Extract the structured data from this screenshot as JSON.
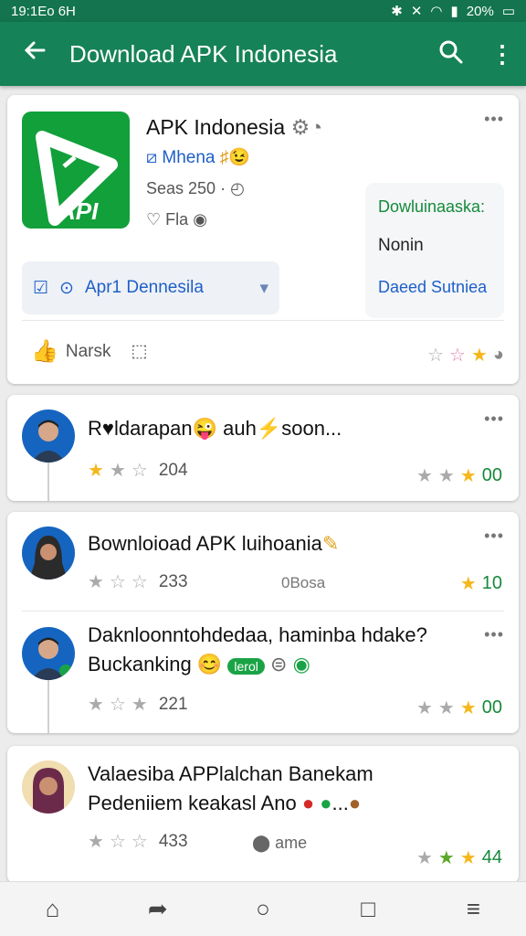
{
  "status_bar": {
    "time": "19:16",
    "left_text": "19:1Eo 6H",
    "battery": "20%"
  },
  "app_bar": {
    "title": "Download APK Indonesia"
  },
  "app_card": {
    "name": "APK Indonesia",
    "developer": "Mhena",
    "meta_line1": "Seas 250",
    "meta_line2": "Fla",
    "logo_text": "API",
    "side_title": "Dowluinaaska:",
    "side_value": "Nonin",
    "side_link": "Daeed Sutniea",
    "dropdown_label": "Apr1 Dennesila",
    "like_label": "Narsk"
  },
  "reviews": [
    {
      "title": "R♥ldarapan",
      "title_tail": "auh",
      "title_end": "soon...",
      "rating_count": "204",
      "right_score": "00"
    },
    {
      "title": "Bownloioad APK luihoania",
      "rating_count": "233",
      "middle": "0Bosa",
      "right_score": "10"
    },
    {
      "title": "Daknloonntohdedaa, haminba hdake?",
      "title_line2": "Buckanking",
      "tag": "lerol",
      "rating_count": "221",
      "right_score": "00"
    },
    {
      "title": "Valaesiba APPlalchan Banekam",
      "title_line2": "Pedeniiem keakasl Ano",
      "rating_count": "433",
      "middle": "ame",
      "right_score": "44"
    }
  ],
  "icons": {
    "back": "arrow-left-icon",
    "search": "search-icon",
    "more": "more-vertical-icon",
    "nav": [
      "home-icon",
      "share-icon",
      "circle-icon",
      "square-icon",
      "menu-icon"
    ]
  }
}
